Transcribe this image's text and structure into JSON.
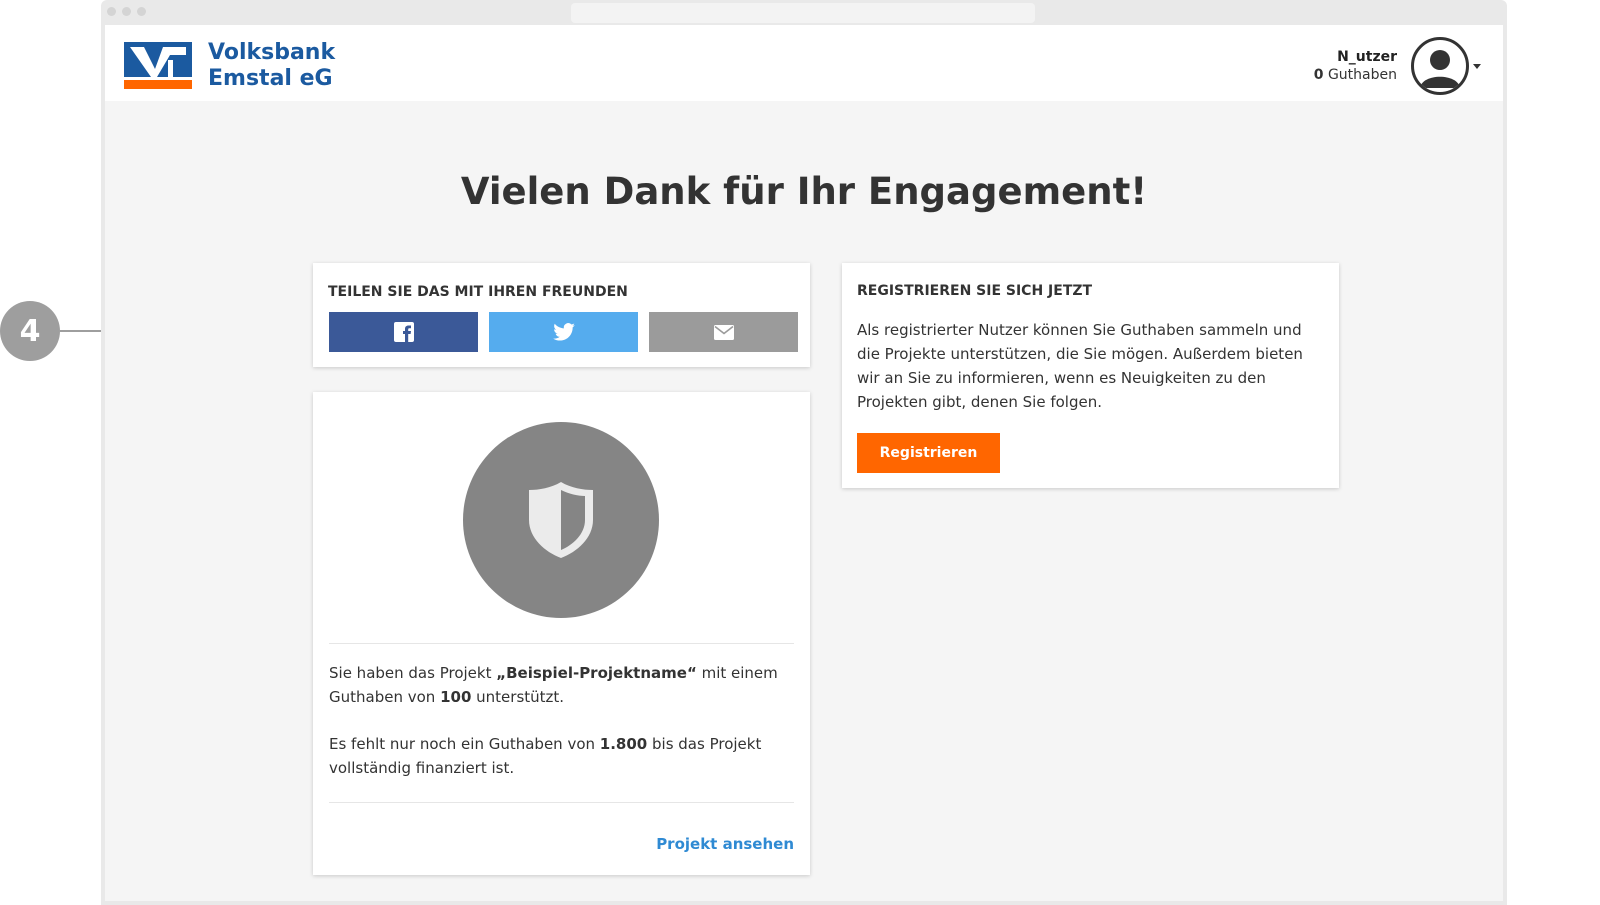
{
  "annotation": {
    "number": "4"
  },
  "brand": {
    "line1": "Volksbank",
    "line2": "Emstal eG",
    "blue": "#1b5aa0",
    "orange": "#ff6600"
  },
  "user": {
    "name": "N_utzer",
    "credit_value": "0",
    "credit_label": "Guthaben"
  },
  "page": {
    "title": "Vielen Dank für Ihr Engagement!"
  },
  "share": {
    "title": "TEILEN SIE DAS MIT IHREN FREUNDEN",
    "buttons": [
      {
        "icon": "facebook-icon",
        "color": "#3b5998"
      },
      {
        "icon": "twitter-icon",
        "color": "#55acee"
      },
      {
        "icon": "mail-icon",
        "color": "#9b9b9b"
      }
    ]
  },
  "project": {
    "icon": "shield-icon",
    "p1_pre": "Sie haben das Projekt ",
    "p1_name": "„Beispiel-Projektname“",
    "p1_mid": " mit einem Guthaben von ",
    "p1_amount": "100",
    "p1_post": " unterstützt.",
    "p2_pre": "Es fehlt nur noch ein Guthaben von ",
    "p2_amount": "1.800",
    "p2_post": " bis das Projekt vollständig finanziert ist.",
    "link": "Projekt ansehen"
  },
  "register": {
    "title": "REGISTRIEREN SIE SICH JETZT",
    "text": "Als registrierter Nutzer können Sie Guthaben sammeln und die Projekte unterstützen, die Sie mögen. Außerdem bieten wir an Sie zu informieren, wenn es Neuigkeiten zu den Projekten gibt, denen Sie folgen.",
    "button": "Registrieren"
  }
}
